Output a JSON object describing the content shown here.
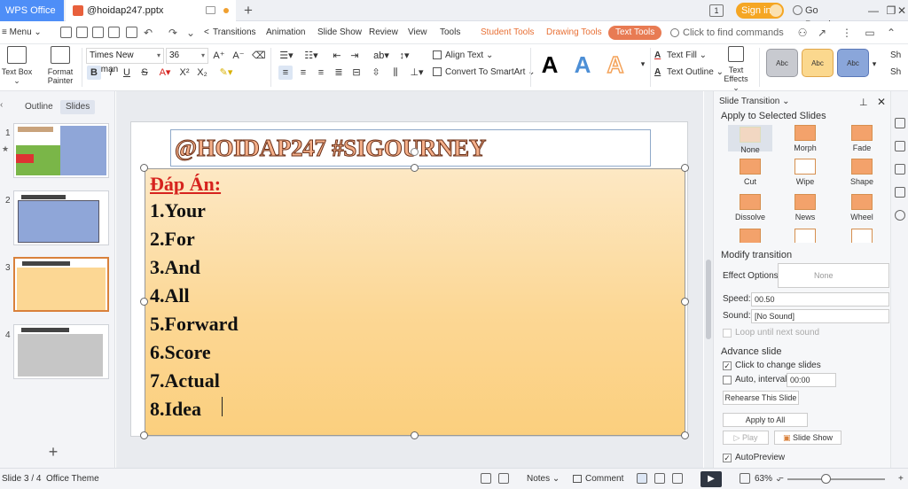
{
  "titlebar": {
    "app_tab": "WPS Office",
    "doc_tab": "@hoidap247.pptx",
    "new_tab_plus": "+",
    "signin": "Sign in",
    "go_premium": "Go Premium",
    "box_icon_label": "1"
  },
  "menubar": {
    "menu_label": "≡ Menu ⌄",
    "items": [
      "Transitions",
      "Animation",
      "Slide Show",
      "Review",
      "View",
      "Tools",
      "Student Tools",
      "Drawing Tools",
      "Text Tools"
    ],
    "search_placeholder": "Click to find commands",
    "nav_arrow": "<"
  },
  "ribbon": {
    "text_box": "Text Box ⌄",
    "format_painter": "Format Painter",
    "font_name": "Times New Roman",
    "font_size": "36",
    "align_text": "Align Text ⌄",
    "convert_smartart": "Convert To SmartArt ⌄",
    "text_fill": "Text Fill ⌄",
    "text_outline": "Text Outline ⌄",
    "text_effects": "Text Effects ⌄",
    "wordart_letter": "A",
    "style_sample": "Abc",
    "overflow_label": "Sh",
    "colors": {
      "wordart_black": "#000000",
      "wordart_blue": "#4d8fd6",
      "wordart_orange": "#f4a35a",
      "style_gray": "#c8cad0",
      "style_yellow": "#fbd88e",
      "style_blue": "#8aa6da"
    }
  },
  "leftpanel": {
    "tabs": [
      "Outline",
      "Slides"
    ],
    "active_tab": "Slides",
    "slide_numbers": [
      "1",
      "2",
      "3",
      "4"
    ],
    "selected_slide": "3"
  },
  "slide": {
    "title": "@HOIDAP247 #SIGOURNEY",
    "heading": "Đáp Án:",
    "answers": [
      "1.Your",
      "2.For",
      "3.And",
      "4.All",
      "5.Forward",
      "6.Score",
      "7.Actual",
      "8.Idea"
    ],
    "colors": {
      "heading": "#d6231e",
      "fill_top": "#fde8c4",
      "fill_bottom": "#fbcf7e"
    }
  },
  "rightpanel": {
    "header": "Slide Transition ⌄",
    "subheader": "Apply to Selected Slides",
    "transitions": [
      "None",
      "Morph",
      "Fade",
      "Cut",
      "Wipe",
      "Shape",
      "Dissolve",
      "News",
      "Wheel"
    ],
    "selected_transition": "None",
    "modify_heading": "Modify transition",
    "effect_options_label": "Effect Options:",
    "effect_options_value": "None",
    "speed_label": "Speed:",
    "speed_value": "00.50",
    "sound_label": "Sound:",
    "sound_value": "[No Sound]",
    "loop_label": "Loop until next sound",
    "advance_heading": "Advance slide",
    "click_change_label": "Click to change slides",
    "click_change_checked": true,
    "auto_interval_label": "Auto, interval:",
    "auto_interval_value": "00:00",
    "rehearse_button": "Rehearse This Slide",
    "apply_all_button": "Apply to All",
    "play_button": "Play",
    "slideshow_button": "Slide Show",
    "autopreview_label": "AutoPreview",
    "autopreview_checked": true
  },
  "statusbar": {
    "slide_indicator": "Slide 3 / 4",
    "theme": "Office Theme",
    "notes": "Notes ⌄",
    "comment": "Comment",
    "zoom": "63% ⌄",
    "zoom_minus": "−",
    "zoom_plus": "+"
  }
}
